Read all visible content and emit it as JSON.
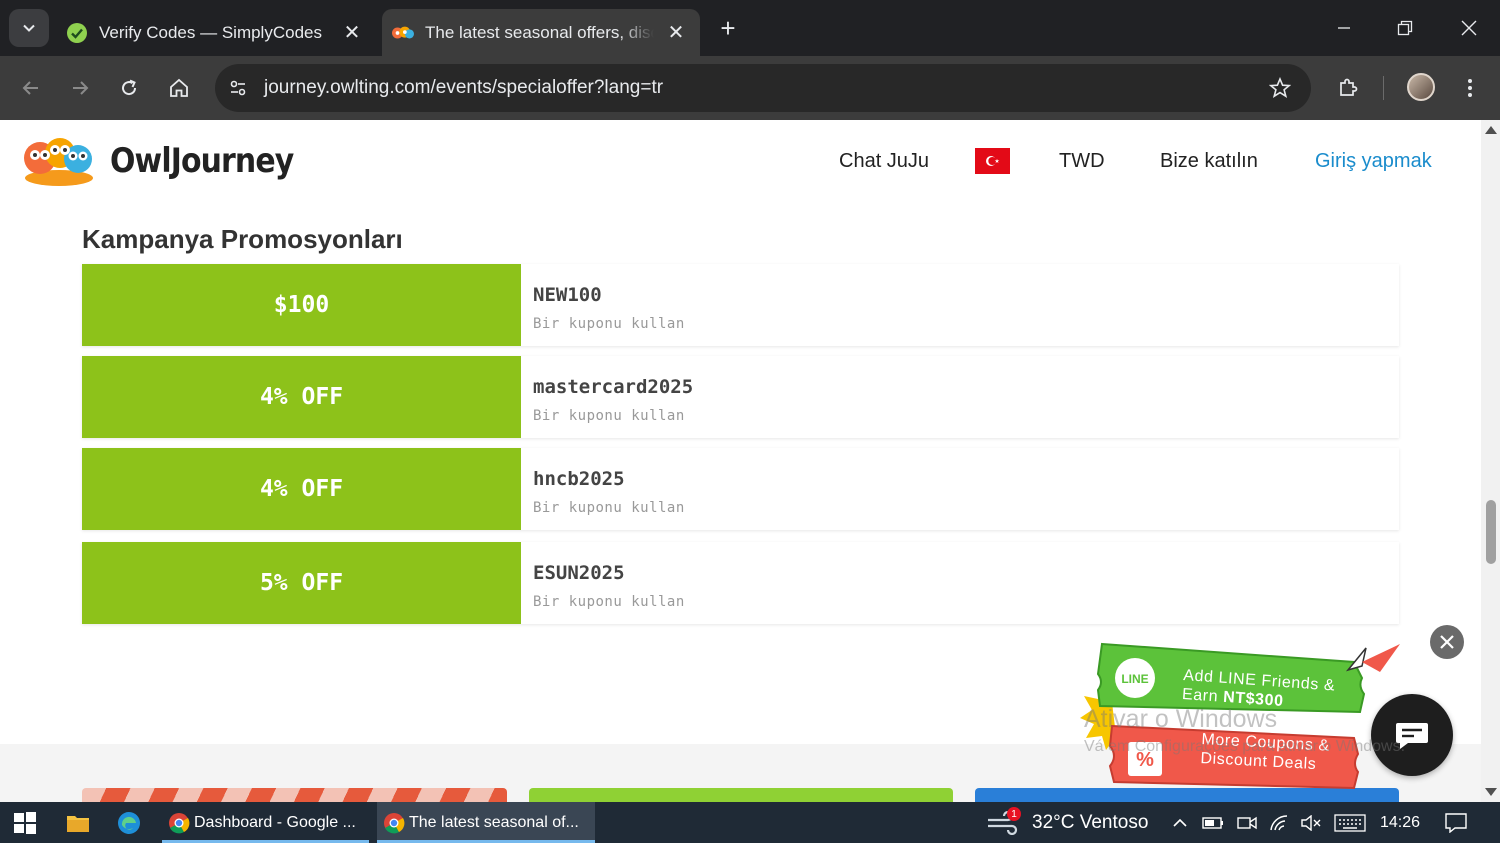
{
  "browser": {
    "tabs": [
      {
        "title": "Verify Codes — SimplyCodes",
        "active": false,
        "icon": "simplycodes-favicon-icon"
      },
      {
        "title": "The latest seasonal offers, disco",
        "active": true,
        "icon": "owljourney-favicon-icon"
      }
    ],
    "url": "journey.owlting.com/events/specialoffer?lang=tr"
  },
  "site": {
    "logo_text": "OwlJourney",
    "nav": {
      "chat": "Chat JuJu",
      "currency": "TWD",
      "join": "Bize katılın",
      "login": "Giriş yapmak"
    }
  },
  "section": {
    "title": "Kampanya Promosyonları"
  },
  "coupons": [
    {
      "value": "$100",
      "code": "NEW100",
      "action": "Bir kuponu kullan"
    },
    {
      "value": "4% OFF",
      "code": "mastercard2025",
      "action": "Bir kuponu kullan"
    },
    {
      "value": "4% OFF",
      "code": "hncb2025",
      "action": "Bir kuponu kullan"
    },
    {
      "value": "5% OFF",
      "code": "ESUN2025",
      "action": "Bir kuponu kullan"
    }
  ],
  "promo": {
    "line_prefix": "Add LINE Friends &",
    "line_earn_prefix": "Earn ",
    "line_earn_amount": "NT$300",
    "line_logo": "LINE",
    "coupon_line1": "More Coupons &",
    "coupon_line2": "Discount Deals"
  },
  "watermark": {
    "line1": "Ativar o Windows",
    "line2": "Vá em Configurações para ativar o Windows."
  },
  "taskbar": {
    "apps": [
      {
        "label": "Dashboard - Google ..."
      },
      {
        "label": "The latest seasonal of..."
      }
    ],
    "weather": "32°C  Ventoso",
    "weather_badge": "1",
    "time": "14:26"
  },
  "colors": {
    "coupon_green": "#8dc21a",
    "login_blue": "#1a8ccc",
    "promo_green": "#5cc23a",
    "promo_red": "#f0584a"
  }
}
